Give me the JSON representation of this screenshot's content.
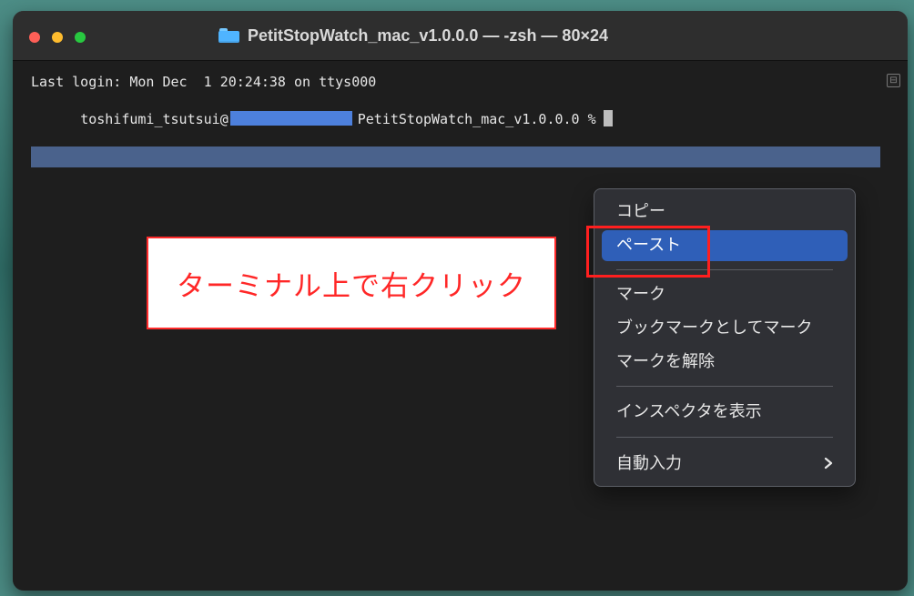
{
  "window": {
    "title": "PetitStopWatch_mac_v1.0.0.0 — -zsh — 80×24"
  },
  "terminal": {
    "line1": "Last login: Mon Dec  1 20:24:38 on ttys000",
    "line2_prefix": "toshifumi_tsutsui@",
    "line2_suffix": "PetitStopWatch_mac_v1.0.0.0 %",
    "scroll_icon": "⊟"
  },
  "annotation": {
    "text": "ターミナル上で右クリック"
  },
  "context_menu": {
    "items": [
      {
        "label": "コピー"
      },
      {
        "label": "ペースト"
      },
      {
        "label": "マーク"
      },
      {
        "label": "ブックマークとしてマーク"
      },
      {
        "label": "マークを解除"
      },
      {
        "label": "インスペクタを表示"
      },
      {
        "label": "自動入力"
      }
    ],
    "submenu_icon": "chevron-right-icon"
  },
  "colors": {
    "desktop": "#3f7d77",
    "terminal_bg": "#1e1e1e",
    "selection": "#4a628c",
    "menu_bg": "#2f3035",
    "menu_highlight": "#2f5fb8",
    "annotation_border": "#ff2b2b",
    "annotation_text": "#ff2727"
  }
}
